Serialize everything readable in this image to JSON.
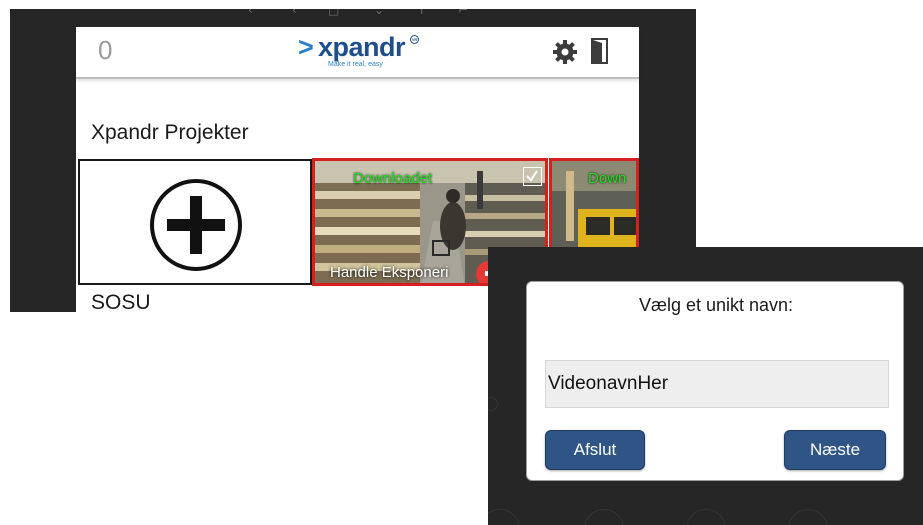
{
  "header": {
    "counter": "0",
    "logo_text": "xpandr",
    "logo_tagline": "Make it real, easy",
    "logo_badge": "VR"
  },
  "sections": {
    "projects_title": "Xpandr Projekter",
    "next_title": "SOSU"
  },
  "tiles": [
    {
      "status": "Downloadet",
      "name": "Handle Eksponeri",
      "checked": true
    },
    {
      "status": "Down"
    }
  ],
  "dialog": {
    "title": "Vælg et unikt navn:",
    "input_value": "VideonavnHer",
    "quit_label": "Afslut",
    "next_label": "Næste"
  },
  "colors": {
    "status_green": "#1fe01f",
    "tile_border": "#d61f1f",
    "button_blue": "#2f5486",
    "logo_blue": "#1e4f8c",
    "dark_bg": "#262626"
  },
  "icons": [
    "gear-icon",
    "exit-door-icon",
    "plus-circle-icon",
    "checkbox-icon"
  ]
}
